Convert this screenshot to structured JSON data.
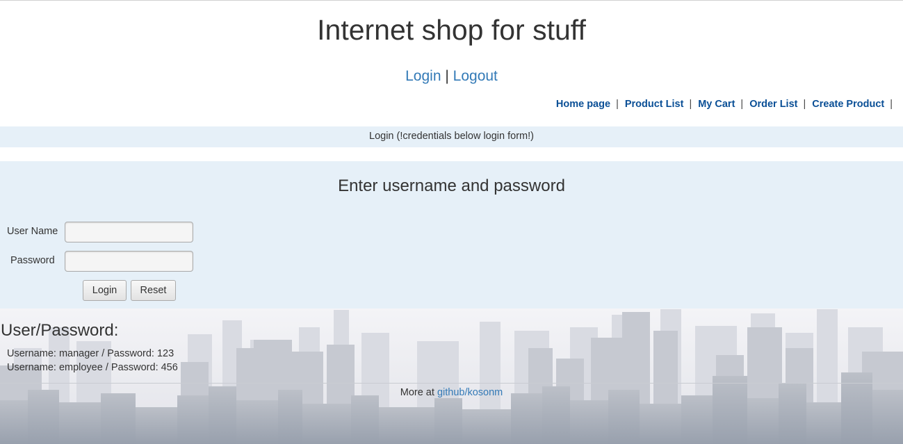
{
  "header": {
    "title": "Internet shop for stuff",
    "login_link": "Login",
    "divider": "|",
    "logout_link": "Logout"
  },
  "menu": {
    "items": [
      {
        "label": "Home page"
      },
      {
        "label": "Product List"
      },
      {
        "label": "My Cart"
      },
      {
        "label": "Order List"
      },
      {
        "label": "Create Product"
      }
    ],
    "separator": "|"
  },
  "page_heading": "Login (!credentials below login form!)",
  "login_form": {
    "heading": "Enter username and password",
    "username_label": "User Name",
    "username_value": "",
    "password_label": "Password",
    "password_value": "",
    "login_button": "Login",
    "reset_button": "Reset"
  },
  "credentials": {
    "title": "User/Password:",
    "lines": [
      "Username: manager / Password: 123",
      "Username: employee / Password: 456"
    ]
  },
  "footer": {
    "prefix": "More at",
    "link": "github/kosonm"
  },
  "colors": {
    "link": "#337ab7",
    "menu_link": "#0a4f96",
    "panel_bg": "#e6f0f8",
    "skyline_far": "#d6d8e0",
    "skyline_near": "#a7adb7"
  }
}
